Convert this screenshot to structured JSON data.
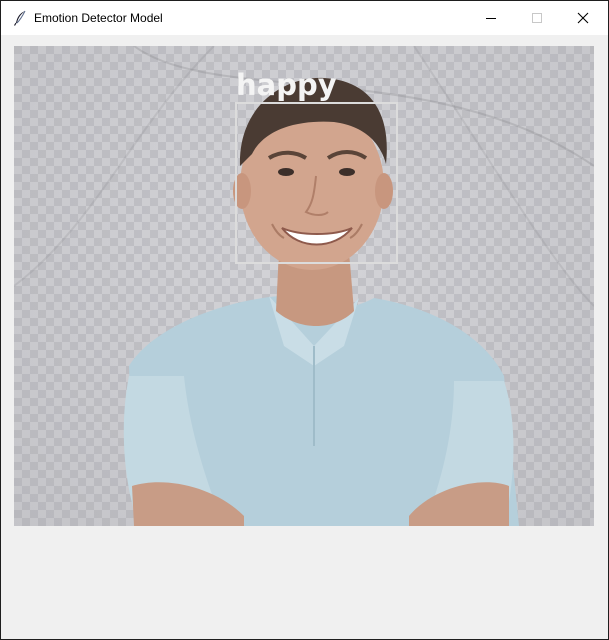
{
  "window": {
    "title": "Emotion Detector Model",
    "app_icon": "feather-icon",
    "controls": [
      "minimize-icon",
      "maximize-icon",
      "close-icon"
    ]
  },
  "video": {
    "detections": [
      {
        "label": "happy"
      }
    ]
  }
}
